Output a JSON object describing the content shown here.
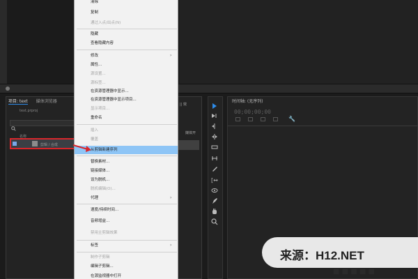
{
  "project_panel": {
    "tabs": [
      "项目: text",
      "媒体浏览器"
    ],
    "file": "text.prproj",
    "column_header": "名称",
    "clip_label": "剪辑 / 合成",
    "right_tab_label": "|| 效",
    "right_col_label": "媒体开"
  },
  "timeline": {
    "title": "时间轴: (无序列)",
    "timecode": "00;00;00;00"
  },
  "context_menu": {
    "items": [
      {
        "label": "清除",
        "enabled": true
      },
      {
        "label": "复制",
        "enabled": true
      },
      {
        "label": "通过入点/出点(N)",
        "enabled": false
      },
      {
        "label": "隐藏",
        "enabled": true
      },
      {
        "label": "查看隐藏内容",
        "enabled": true
      },
      {
        "label": "修改",
        "enabled": true,
        "submenu": true
      },
      {
        "label": "属性...",
        "enabled": true
      },
      {
        "label": "源设置...",
        "enabled": false
      },
      {
        "label": "源标签...",
        "enabled": false
      },
      {
        "label": "在资源管理器中显示...",
        "enabled": true
      },
      {
        "label": "在资源管理器中显示项目...",
        "enabled": true
      },
      {
        "label": "显示项目...",
        "enabled": false
      },
      {
        "label": "重命名",
        "enabled": true
      },
      {
        "label": "插入",
        "enabled": false
      },
      {
        "label": "覆盖",
        "enabled": false
      },
      {
        "label": "从剪辑新建序列",
        "enabled": true,
        "highlighted": true
      },
      {
        "label": "替换素材...",
        "enabled": true
      },
      {
        "label": "链接媒体...",
        "enabled": true
      },
      {
        "label": "设为脱机...",
        "enabled": true
      },
      {
        "label": "脱机编辑(O)...",
        "enabled": false
      },
      {
        "label": "代理",
        "enabled": true,
        "submenu": true
      },
      {
        "label": "速度/持续时间...",
        "enabled": true
      },
      {
        "label": "音频增益...",
        "enabled": true
      },
      {
        "label": "禁用主剪辑效果",
        "enabled": false
      },
      {
        "label": "标签",
        "enabled": true,
        "submenu": true
      },
      {
        "label": "制作子剪辑",
        "enabled": false
      },
      {
        "label": "编辑子剪辑...",
        "enabled": true
      },
      {
        "label": "在源监视器中打开",
        "enabled": true
      }
    ]
  },
  "watermark": {
    "text": "来源：H12.NET",
    "under_text": "■ ■ ■ ■ ■"
  },
  "colors": {
    "highlight": "#8ec5f6",
    "annotation_red": "#d9262b",
    "accent_blue": "#2d8ceb"
  },
  "icons": [
    "search-icon",
    "wrench-icon",
    "selection-tool-icon",
    "hand-tool-icon",
    "zoom-tool-icon",
    "pen-tool-icon",
    "razor-tool-icon"
  ]
}
